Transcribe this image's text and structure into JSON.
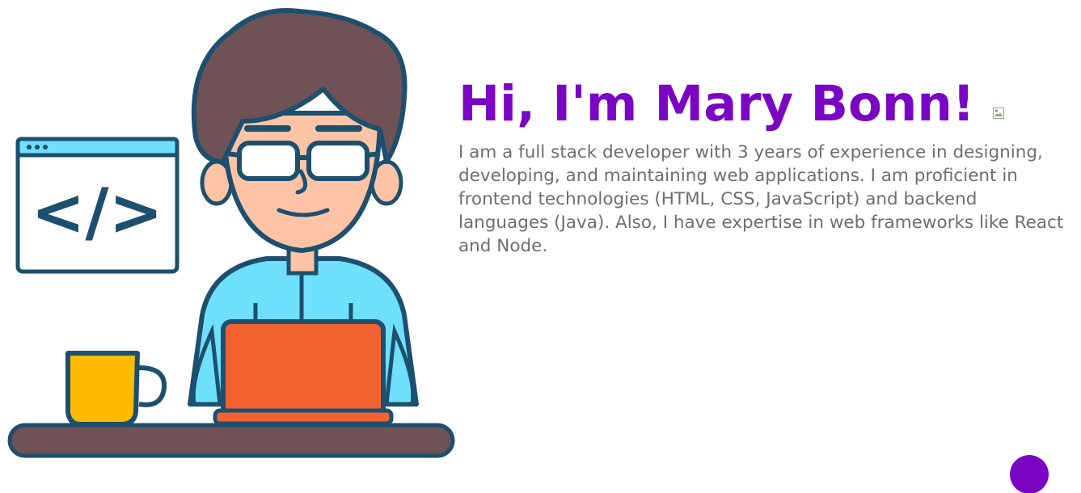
{
  "hero": {
    "title": "Hi, I'm Mary Bonn!",
    "bio": "I am a full stack developer with 3 years of experience in designing, developing, and maintaining web applications. I am proficient in frontend technologies (HTML, CSS, JavaScript) and backend languages (Java). Also, I have expertise in web frameworks like React and Node.",
    "illustration_icon": "developer-at-laptop-illustration",
    "code_window_glyph": "</>",
    "broken_image_icon": "broken-image-icon"
  },
  "fab": {
    "icon": "scroll-button-icon"
  },
  "colors": {
    "accent": "#7a06c4",
    "body_text": "#6e6e6e",
    "background": "#ffffff"
  }
}
